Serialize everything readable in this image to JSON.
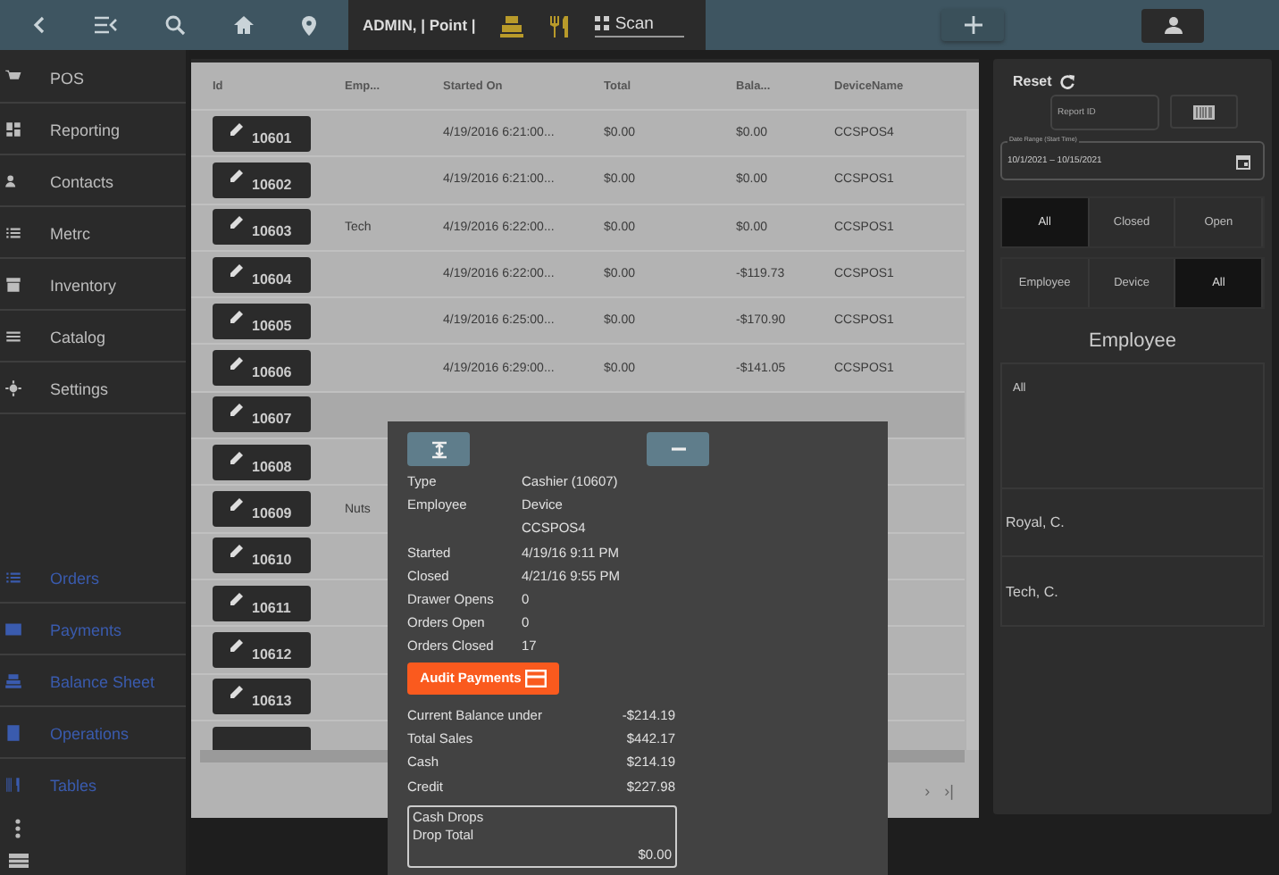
{
  "topbar": {
    "user_label": "ADMIN, | Point |",
    "scan": {
      "value": "Scan"
    }
  },
  "sidebar": {
    "items": [
      "POS",
      "Reporting",
      "Contacts",
      "Metrc",
      "Inventory",
      "Catalog",
      "Settings"
    ],
    "sub_items": [
      "Orders",
      "Payments",
      "Balance Sheet",
      "Operations",
      "Tables"
    ]
  },
  "table": {
    "columns": [
      "Id",
      "Emp...",
      "Started On",
      "Total",
      "Bala...",
      "DeviceName"
    ],
    "rows": [
      {
        "id": "10601",
        "started": "4/19/2016 6:21:00...",
        "total": "$0.00",
        "balance": "$0.00",
        "device": "CCSPOS4"
      },
      {
        "id": "10602",
        "started": "4/19/2016 6:21:00...",
        "total": "$0.00",
        "balance": "$0.00",
        "device": "CCSPOS1"
      },
      {
        "id": "10603",
        "employee": "Tech",
        "started": "4/19/2016 6:22:00...",
        "total": "$0.00",
        "balance": "$0.00",
        "device": "CCSPOS1"
      },
      {
        "id": "10604",
        "started": "4/19/2016 6:22:00...",
        "total": "$0.00",
        "balance": "-$119.73",
        "device": "CCSPOS1"
      },
      {
        "id": "10605",
        "started": "4/19/2016 6:25:00...",
        "total": "$0.00",
        "balance": "-$170.90",
        "device": "CCSPOS1"
      },
      {
        "id": "10606",
        "started": "4/19/2016 6:29:00...",
        "total": "$0.00",
        "balance": "-$141.05",
        "device": "CCSPOS1"
      },
      {
        "id": "10607"
      },
      {
        "id": "10608"
      },
      {
        "id": "10609",
        "employee": "Nuts"
      },
      {
        "id": "10610"
      },
      {
        "id": "10611"
      },
      {
        "id": "10612"
      },
      {
        "id": "10613"
      }
    ],
    "pagination": [
      "›",
      "›|"
    ]
  },
  "filters": {
    "reset": "Reset",
    "report_id": {
      "placeholder": "Report ID"
    },
    "date_range": {
      "label": "Date Range (Start Time)",
      "value": "10/1/2021 – 10/15/2021"
    },
    "status": [
      {
        "label": "All",
        "selected": true
      },
      {
        "label": "Closed",
        "selected": false
      },
      {
        "label": "Open",
        "selected": false
      }
    ],
    "group": [
      {
        "label": "Employee",
        "selected": false
      },
      {
        "label": "Device",
        "selected": false
      },
      {
        "label": "All",
        "selected": true
      }
    ],
    "list_title": "Employee",
    "list": [
      "All",
      "Royal, C.",
      "Tech, C."
    ]
  },
  "dialog": {
    "details": [
      {
        "label": "Type",
        "value": "Cashier (10607)"
      },
      {
        "label": "Employee",
        "value": "Device"
      },
      {
        "value": "CCSPOS4"
      },
      {
        "label": "Started",
        "value": "4/19/16 9:11 PM"
      },
      {
        "label": "Closed",
        "value": "4/21/16 9:55 PM"
      },
      {
        "label": "Drawer Opens",
        "value": "0"
      },
      {
        "label": "Orders Open",
        "value": "0"
      },
      {
        "label": "Orders Closed",
        "value": "17"
      }
    ],
    "audit_button": "Audit Payments",
    "summary": [
      {
        "label": "Current Balance under",
        "value": "-$214.19"
      },
      {
        "label": "Total Sales",
        "value": "$442.17"
      },
      {
        "label": "Cash",
        "value": "$214.19"
      },
      {
        "label": "Credit",
        "value": "$227.98"
      }
    ],
    "cash_drops": {
      "title": "Cash Drops",
      "label": "Drop Total",
      "value": "$0.00"
    }
  }
}
